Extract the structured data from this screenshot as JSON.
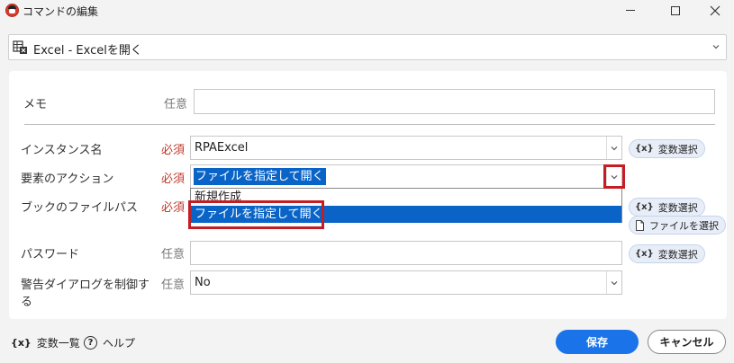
{
  "window": {
    "title": "コマンドの編集"
  },
  "command": {
    "selected": "Excel - Excelを開く"
  },
  "fields": {
    "memo": {
      "label": "メモ",
      "tag": "任意",
      "value": ""
    },
    "instance": {
      "label": "インスタンス名",
      "tag": "必須",
      "value": "RPAExcel",
      "var_button": "変数選択"
    },
    "action": {
      "label": "要素のアクション",
      "tag": "必須",
      "value": "ファイルを指定して開く"
    },
    "filepath": {
      "label": "ブックのファイルパス",
      "tag": "必須",
      "var_button": "変数選択",
      "file_button": "ファイルを選択"
    },
    "password": {
      "label": "パスワード",
      "tag": "任意",
      "value": "",
      "var_button": "変数選択"
    },
    "dialog": {
      "label_line1": "警告ダイアログを制御す",
      "label_line2": "る",
      "tag": "任意",
      "value": "No"
    }
  },
  "dropdown": {
    "options": [
      "新規作成",
      "ファイルを指定して開く"
    ],
    "selected_index": 1
  },
  "footer": {
    "variables_icon": "{x}",
    "variables": "変数一覧",
    "help_icon": "?",
    "help": "ヘルプ",
    "save": "保存",
    "cancel": "キャンセル"
  },
  "colors": {
    "accent": "#1a73e8",
    "selection": "#0a64c8",
    "required": "#c0392b",
    "highlight_box": "#c41e24"
  }
}
